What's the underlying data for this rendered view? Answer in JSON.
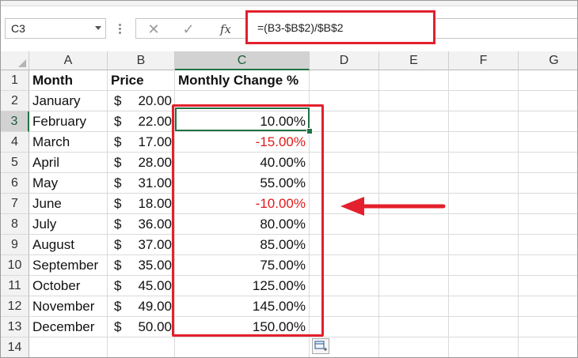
{
  "formula_bar": {
    "name_box": "C3",
    "formula": "=(B3-$B$2)/$B$2",
    "icons": [
      "cancel-icon",
      "enter-icon",
      "function-icon"
    ]
  },
  "columns": [
    "A",
    "B",
    "C",
    "D",
    "E",
    "F",
    "G"
  ],
  "selected_column": "C",
  "selected_row": 3,
  "row_numbers": [
    "1",
    "2",
    "3",
    "4",
    "5",
    "6",
    "7",
    "8",
    "9",
    "10",
    "11",
    "12",
    "13",
    "14"
  ],
  "headers": {
    "month": "Month",
    "price": "Price",
    "change": "Monthly Change %"
  },
  "rows": [
    {
      "month": "January",
      "currency": "$",
      "price": "20.00",
      "change": ""
    },
    {
      "month": "February",
      "currency": "$",
      "price": "22.00",
      "change": "10.00%"
    },
    {
      "month": "March",
      "currency": "$",
      "price": "17.00",
      "change": "-15.00%"
    },
    {
      "month": "April",
      "currency": "$",
      "price": "28.00",
      "change": "40.00%"
    },
    {
      "month": "May",
      "currency": "$",
      "price": "31.00",
      "change": "55.00%"
    },
    {
      "month": "June",
      "currency": "$",
      "price": "18.00",
      "change": "-10.00%"
    },
    {
      "month": "July",
      "currency": "$",
      "price": "36.00",
      "change": "80.00%"
    },
    {
      "month": "August",
      "currency": "$",
      "price": "37.00",
      "change": "85.00%"
    },
    {
      "month": "September",
      "currency": "$",
      "price": "35.00",
      "change": "75.00%"
    },
    {
      "month": "October",
      "currency": "$",
      "price": "45.00",
      "change": "125.00%"
    },
    {
      "month": "November",
      "currency": "$",
      "price": "49.00",
      "change": "145.00%"
    },
    {
      "month": "December",
      "currency": "$",
      "price": "50.00",
      "change": "150.00%"
    }
  ],
  "colors": {
    "accent_green": "#217346",
    "annotation_red": "#e3202d",
    "negative_red": "#e01a1a"
  }
}
